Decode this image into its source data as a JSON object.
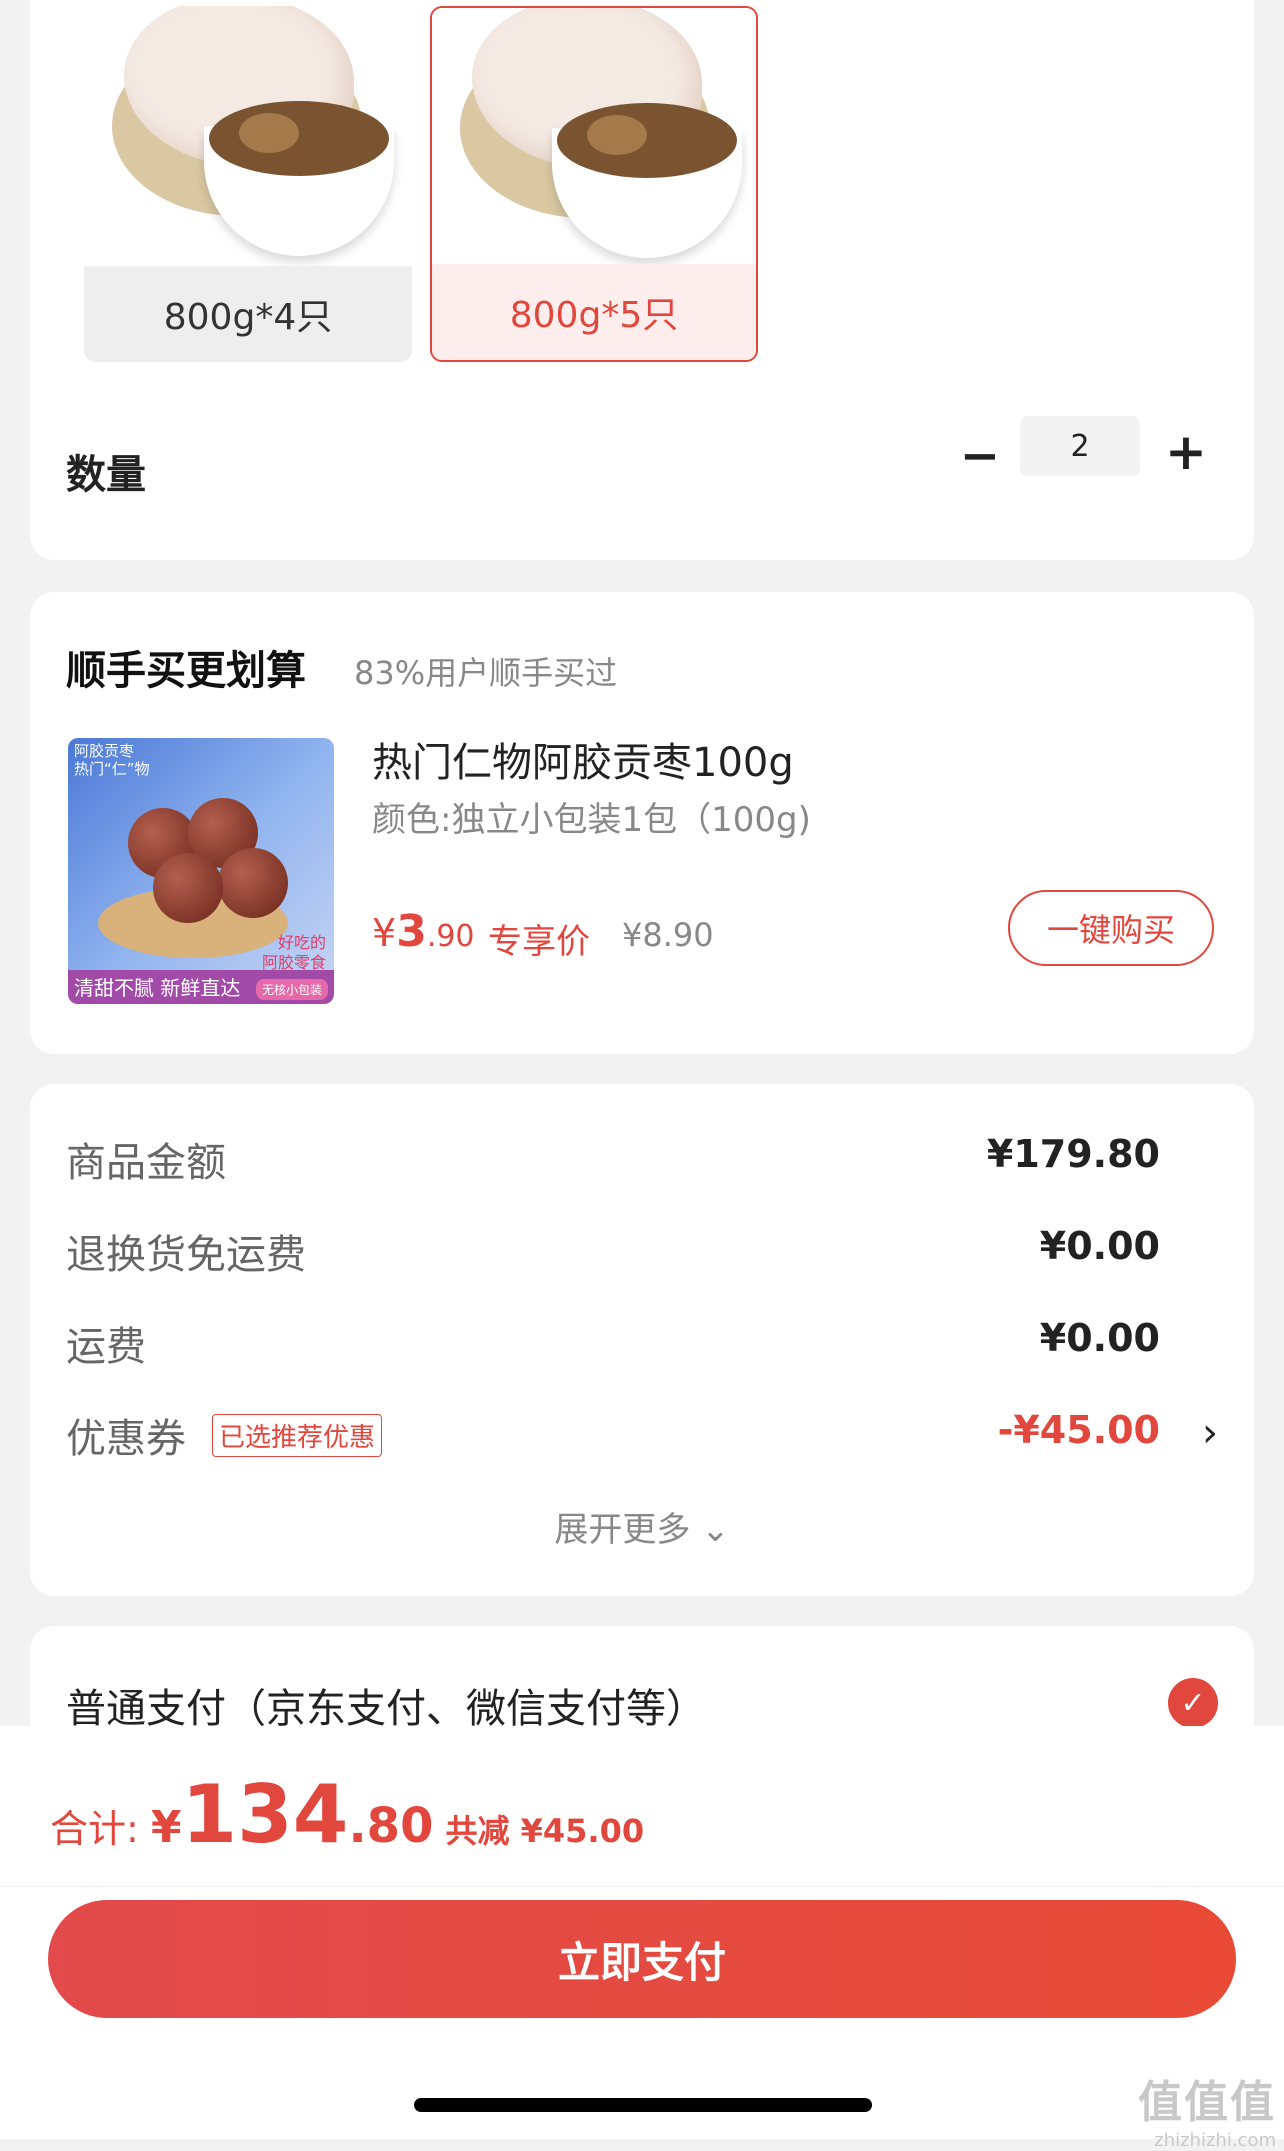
{
  "spec": {
    "options": [
      {
        "label": "800g*4只",
        "selected": false
      },
      {
        "label": "800g*5只",
        "selected": true
      }
    ],
    "quantity_label": "数量",
    "quantity_value": "2",
    "minus_symbol": "−",
    "plus_symbol": "+"
  },
  "upsell": {
    "title": "顺手买更划算",
    "subtitle": "83%用户顺手买过",
    "product_name": "热门仁物阿胶贡枣100g",
    "product_spec": "颜色:独立小包装1包（100g)",
    "price_symbol": "¥",
    "price_int": "3",
    "price_dec": ".90",
    "exclusive_label": "专享价",
    "original_price": "¥8.90",
    "buy_button": "一键购买",
    "image_text": {
      "top_left_1": "阿胶贡枣",
      "top_left_2": "热门“仁”物",
      "band": "清甜不腻 新鲜直达",
      "tag": "无核小包装",
      "side_1": "好吃的",
      "side_2": "阿胶零食"
    }
  },
  "summary": {
    "rows": [
      {
        "label": "商品金额",
        "value": "¥179.80"
      },
      {
        "label": "退换货免运费",
        "value": "¥0.00"
      },
      {
        "label": "运费",
        "value": "¥0.00"
      },
      {
        "label": "优惠券",
        "value": "-¥45.00"
      }
    ],
    "coupon_tag": "已选推荐优惠",
    "expand_label": "展开更多 ⌄"
  },
  "payment": {
    "method_label": "普通支付（京东支付、微信支付等）",
    "selected": true
  },
  "bottom": {
    "total_label": "合计:",
    "total_yen": "¥",
    "total_int": "134",
    "total_dec": ".80",
    "saved_text": "共减 ¥45.00",
    "pay_button": "立即支付"
  },
  "watermark": {
    "line1": "值值值",
    "line2": "zhizhizhi.com"
  },
  "colors": {
    "accent": "#e2473d",
    "background": "#f2f2f2"
  }
}
